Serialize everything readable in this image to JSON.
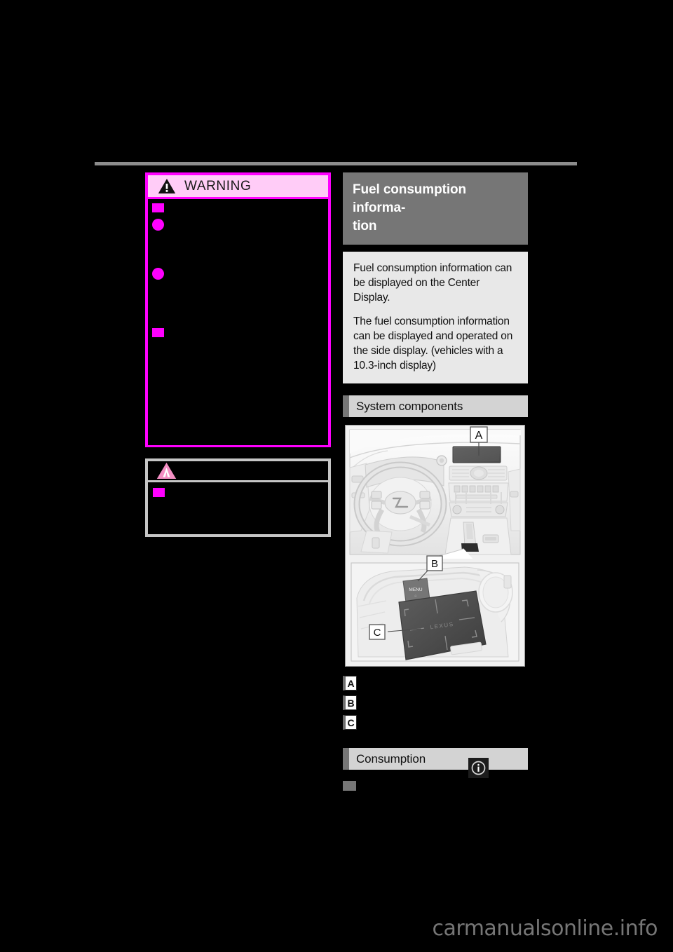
{
  "page": {
    "background_color": "#000000",
    "watermark": "carmanualsonline.info"
  },
  "left_column": {
    "warning_box": {
      "title": "WARNING",
      "icon": "warning-triangle-icon",
      "header_bg": "#ffccf7",
      "border_color": "#ff00ff",
      "bullets": [
        {
          "type": "square",
          "text": ""
        },
        {
          "type": "circle",
          "text": ""
        },
        {
          "type": "circle",
          "text": ""
        },
        {
          "type": "square",
          "text": ""
        }
      ]
    },
    "notice_box": {
      "icon": "notice-triangle-icon",
      "border_color": "#c6c6c6",
      "bullets": [
        {
          "type": "square",
          "text": ""
        }
      ]
    }
  },
  "right_column": {
    "section_title": "Fuel consumption informa-tion",
    "section_title_line1": "Fuel consumption informa-",
    "section_title_line2": "tion",
    "section_title_bg": "#767676",
    "intro_paragraphs": [
      "Fuel consumption information can be displayed on the Center Display.",
      "The fuel consumption information can be displayed and operated on the side display. (vehicles with a 10.3-inch display)"
    ],
    "system_components": {
      "heading": "System components",
      "illustration": {
        "name": "vehicle-interior-illustration",
        "callouts": [
          "A",
          "B",
          "C"
        ],
        "touchpad_label": "LEXUS",
        "menu_button_label": "MENU"
      },
      "legend": [
        {
          "marker": "A",
          "text": ""
        },
        {
          "marker": "B",
          "text": ""
        },
        {
          "marker": "C",
          "text": ""
        }
      ]
    },
    "consumption": {
      "heading": "Consumption",
      "bullets": [
        {
          "type": "gray-square",
          "text": ""
        }
      ],
      "info_icon": "information-icon"
    }
  }
}
